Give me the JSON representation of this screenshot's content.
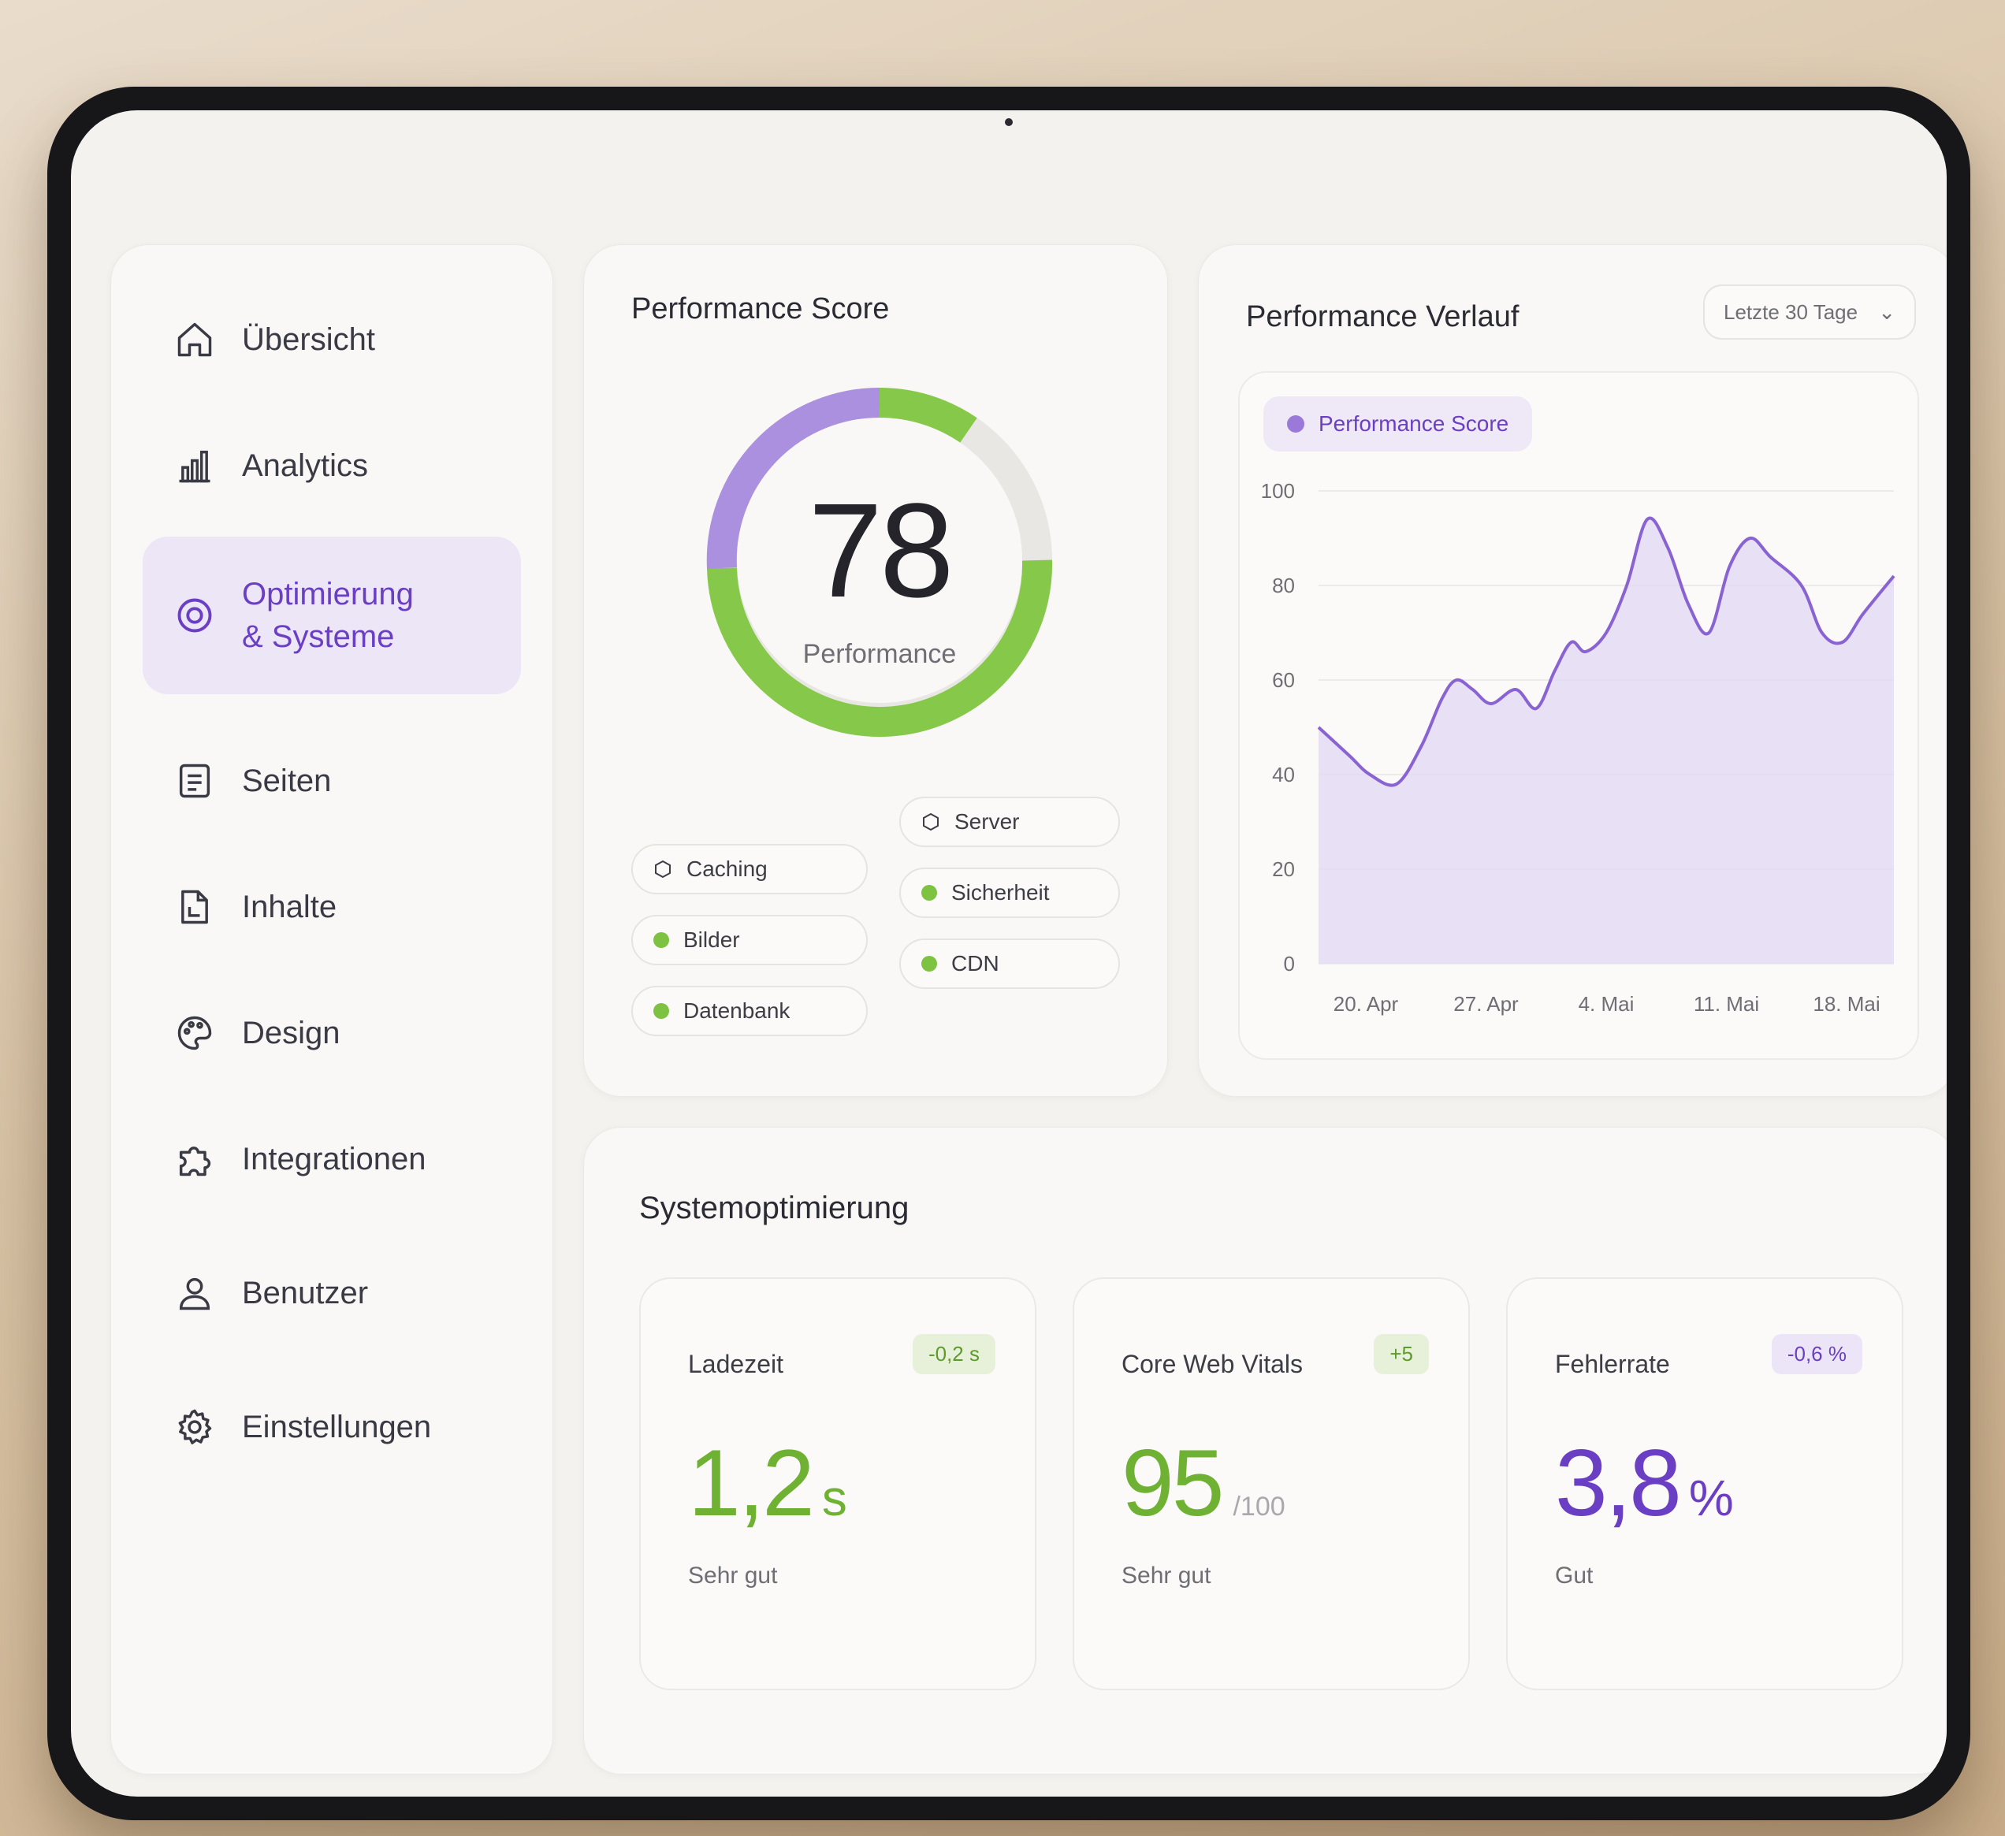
{
  "sidebar": {
    "items": [
      {
        "label": "Übersicht",
        "icon": "home-icon"
      },
      {
        "label": "Analytics",
        "icon": "bar-chart-icon"
      },
      {
        "label": "Optimierung & Systeme",
        "icon": "target-icon",
        "active": true
      },
      {
        "label": "Seiten",
        "icon": "document-icon"
      },
      {
        "label": "Inhalte",
        "icon": "file-icon"
      },
      {
        "label": "Design",
        "icon": "palette-icon"
      },
      {
        "label": "Integrationen",
        "icon": "puzzle-icon"
      },
      {
        "label": "Benutzer",
        "icon": "user-icon"
      },
      {
        "label": "Einstellungen",
        "icon": "gear-icon"
      }
    ]
  },
  "score": {
    "title": "Performance Score",
    "value": "78",
    "label": "Performance",
    "chips": [
      {
        "label": "Caching",
        "status": "pending"
      },
      {
        "label": "Server",
        "status": "pending"
      },
      {
        "label": "Bilder",
        "status": "ok"
      },
      {
        "label": "Sicherheit",
        "status": "ok"
      },
      {
        "label": "Datenbank",
        "status": "ok"
      },
      {
        "label": "CDN",
        "status": "ok"
      }
    ]
  },
  "trend": {
    "title": "Performance Verlauf",
    "range": "Letzte 30 Tage",
    "legend": "Performance Score"
  },
  "chart_data": {
    "type": "area",
    "y_ticks": [
      "0",
      "20",
      "40",
      "60",
      "80",
      "100"
    ],
    "x_ticks": [
      "20. Apr",
      "27. Apr",
      "4. Mai",
      "11. Mai",
      "18. Mai"
    ],
    "ylim": [
      0,
      100
    ],
    "series": [
      {
        "name": "Performance Score",
        "x": [
          0,
          1.5,
          2.5,
          3.8,
          5,
          6,
          6.7,
          7.5,
          8.4,
          9.6,
          10.6,
          11.5,
          12.3,
          13,
          14,
          15,
          16,
          17,
          18,
          19,
          20,
          21,
          22,
          23.5,
          24.5,
          25.5,
          26.5,
          28
        ],
        "values": [
          50,
          44,
          40,
          38,
          46,
          56,
          60,
          58,
          55,
          58,
          54,
          62,
          68,
          66,
          70,
          80,
          94,
          88,
          76,
          70,
          84,
          90,
          86,
          80,
          70,
          68,
          74,
          82
        ]
      }
    ],
    "colors": {
      "line": "#8a63d2",
      "fill": "#e4daf4"
    },
    "grid": true
  },
  "system": {
    "title": "Systemoptimierung",
    "metrics": [
      {
        "label": "Ladezeit",
        "value": "1,2",
        "unit": "s",
        "status": "Sehr gut",
        "badge": "-0,2 s",
        "tone": "green"
      },
      {
        "label": "Core Web Vitals",
        "value": "95",
        "unit": "/100",
        "status": "Sehr gut",
        "badge": "+5",
        "tone": "green"
      },
      {
        "label": "Fehlerrate",
        "value": "3,8",
        "unit": "%",
        "status": "Gut",
        "badge": "-0,6 %",
        "tone": "purple"
      }
    ]
  },
  "colors": {
    "accent": "#6b3fc4",
    "success": "#7ec242",
    "purple_light": "#a98be0"
  }
}
